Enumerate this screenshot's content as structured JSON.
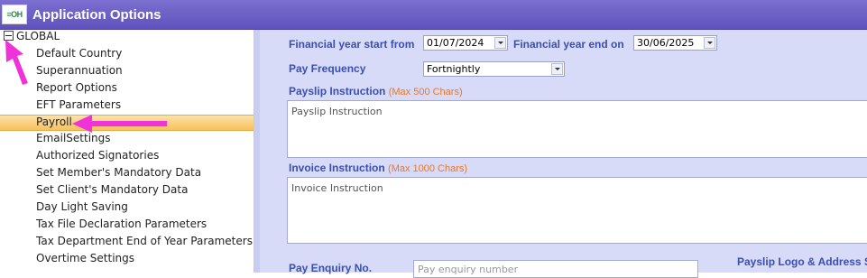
{
  "window": {
    "logo_text": "≡OH",
    "title": "Application Options"
  },
  "tree": {
    "root_label": "GLOBAL",
    "items": [
      "Default Country",
      "Superannuation",
      "Report Options",
      "EFT Parameters",
      "Payroll",
      "EmailSettings",
      "Authorized Signatories",
      "Set Member's Mandatory Data",
      "Set Client's Mandatory Data",
      "Day Light Saving",
      "Tax File Declaration Parameters",
      "Tax Department End of Year Parameters",
      "Overtime Settings"
    ],
    "selected": "Payroll"
  },
  "form": {
    "fy_start_label": "Financial year start from",
    "fy_start_value": "01/07/2024",
    "fy_end_label": "Financial year end on",
    "fy_end_value": "30/06/2025",
    "pay_frequency_label": "Pay Frequency",
    "pay_frequency_value": "Fortnightly",
    "payslip_label": "Payslip Instruction",
    "payslip_note": "(Max 500  Chars)",
    "payslip_placeholder": "Payslip Instruction",
    "invoice_label": "Invoice Instruction",
    "invoice_note": "(Max 1000  Chars)",
    "invoice_placeholder": "Invoice Instruction",
    "pay_enquiry_label": "Pay Enquiry No.",
    "pay_enquiry_placeholder": "Pay enquiry number",
    "logo_section_label": "Payslip Logo & Address S"
  },
  "colors": {
    "title_bar": "#5f52bd",
    "highlight_arrow": "#f033d8",
    "selected_item": "#f7c15e",
    "label_blue": "#3a4fb0",
    "note_orange": "#e8762c"
  }
}
